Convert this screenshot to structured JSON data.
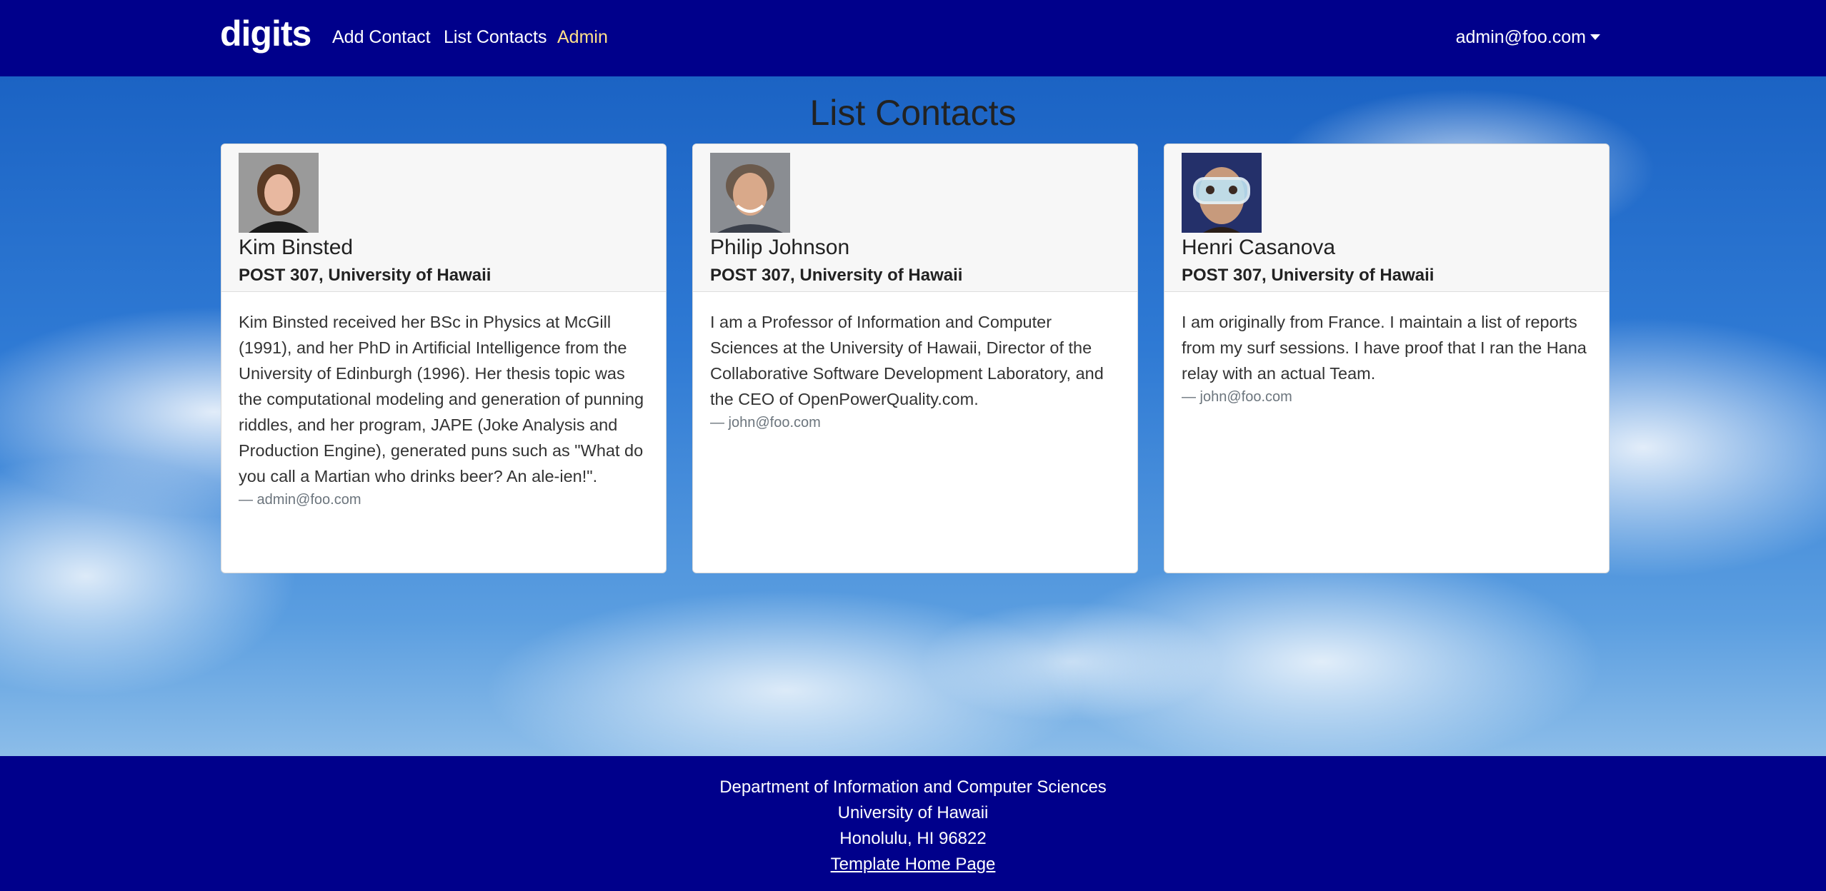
{
  "navbar": {
    "brand": "digits",
    "links": [
      "Add Contact",
      "List Contacts",
      "Admin"
    ],
    "user": "admin@foo.com",
    "colors": {
      "background": "#00008b",
      "active_link": "#ffe08a"
    }
  },
  "page": {
    "title": "List Contacts"
  },
  "contacts": [
    {
      "name": "Kim Binsted",
      "address": "POST 307, University of Hawaii",
      "description": "Kim Binsted received her BSc in Physics at McGill (1991), and her PhD in Artificial Intelligence from the University of Edinburgh (1996). Her thesis topic was the computational modeling and generation of punning riddles, and her program, JAPE (Joke Analysis and Production Engine), generated puns such as \"What do you call a Martian who drinks beer? An ale-ien!\".",
      "owner": "— admin@foo.com"
    },
    {
      "name": "Philip Johnson",
      "address": "POST 307, University of Hawaii",
      "description": "I am a Professor of Information and Computer Sciences at the University of Hawaii, Director of the Collaborative Software Development Laboratory, and the CEO of OpenPowerQuality.com.",
      "owner": "— john@foo.com"
    },
    {
      "name": "Henri Casanova",
      "address": "POST 307, University of Hawaii",
      "description": "I am originally from France. I maintain a list of reports from my surf sessions. I have proof that I ran the Hana relay with an actual Team.",
      "owner": "— john@foo.com"
    }
  ],
  "footer": {
    "lines": [
      "Department of Information and Computer Sciences",
      "University of Hawaii",
      "Honolulu, HI 96822"
    ],
    "link": "Template Home Page"
  }
}
